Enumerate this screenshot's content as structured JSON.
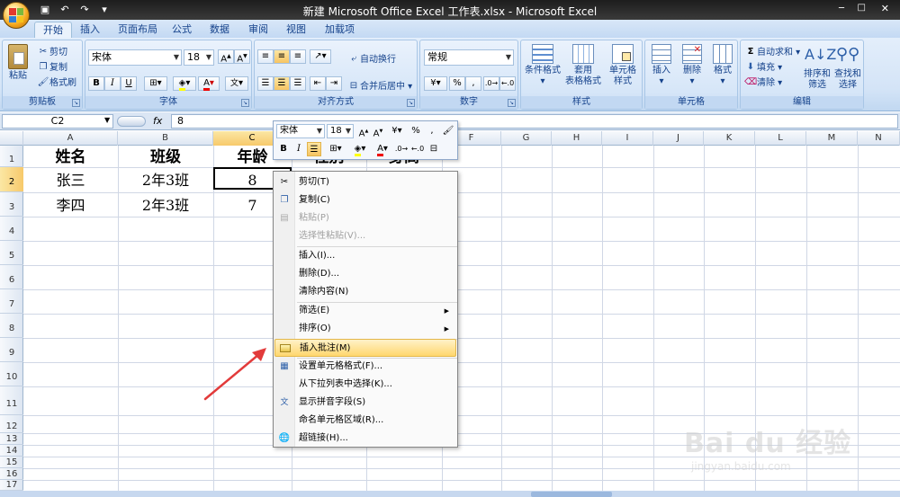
{
  "window": {
    "title": "新建 Microsoft Office Excel 工作表.xlsx - Microsoft Excel"
  },
  "tabs": [
    "开始",
    "插入",
    "页面布局",
    "公式",
    "数据",
    "审阅",
    "视图",
    "加载项"
  ],
  "ribbon": {
    "clipboard": {
      "label": "剪贴板",
      "paste": "粘贴",
      "cut": "剪切",
      "copy": "复制",
      "format_painter": "格式刷"
    },
    "font": {
      "label": "字体",
      "font_name": "宋体",
      "font_size": "18",
      "bold": "B",
      "italic": "I",
      "underline": "U"
    },
    "alignment": {
      "label": "对齐方式",
      "wrap": "自动换行",
      "merge": "合并后居中"
    },
    "number": {
      "label": "数字",
      "format": "常规",
      "percent": "%",
      "comma": ","
    },
    "styles": {
      "label": "样式",
      "conditional": "条件格式",
      "table_l1": "套用",
      "table_l2": "表格格式",
      "cell_l1": "单元格",
      "cell_l2": "样式"
    },
    "cells": {
      "label": "单元格",
      "insert": "插入",
      "delete": "删除",
      "format": "格式"
    },
    "editing": {
      "label": "编辑",
      "autosum": "自动求和",
      "fill": "填充",
      "clear": "清除",
      "sort_l1": "排序和",
      "sort_l2": "筛选",
      "find_l1": "查找和",
      "find_l2": "选择"
    }
  },
  "formula_bar": {
    "name_box": "C2",
    "fx": "fx",
    "value": "8"
  },
  "sheet": {
    "columns": [
      "A",
      "B",
      "C",
      "D",
      "E",
      "F",
      "G",
      "H",
      "I",
      "J",
      "K",
      "L",
      "M",
      "N"
    ],
    "rows": [
      "1",
      "2",
      "3",
      "4",
      "5",
      "6",
      "7",
      "8",
      "9",
      "10",
      "11",
      "12",
      "13",
      "14",
      "15",
      "16",
      "17"
    ],
    "cells": {
      "A1": "姓名",
      "B1": "班级",
      "C1": "年龄",
      "D1": "性别",
      "E1": "身高",
      "A2": "张三",
      "B2": "2年3班",
      "C2": "8",
      "A3": "李四",
      "B3": "2年3班",
      "C3": "7"
    }
  },
  "mini_toolbar": {
    "font_name": "宋体",
    "font_size": "18",
    "percent": "%",
    "comma": ",",
    "bold": "B",
    "italic": "I"
  },
  "context_menu": {
    "items": [
      {
        "label": "剪切(T)",
        "icon": "scissors-icon",
        "disabled": false
      },
      {
        "label": "复制(C)",
        "icon": "copy-icon",
        "disabled": false
      },
      {
        "label": "粘贴(P)",
        "icon": "paste-icon",
        "disabled": true
      },
      {
        "label": "选择性粘贴(V)...",
        "icon": "",
        "disabled": true
      },
      {
        "label": "插入(I)...",
        "icon": "",
        "disabled": false
      },
      {
        "label": "删除(D)...",
        "icon": "",
        "disabled": false
      },
      {
        "label": "清除内容(N)",
        "icon": "",
        "disabled": false
      },
      {
        "label": "筛选(E)",
        "icon": "",
        "disabled": false,
        "submenu": true
      },
      {
        "label": "排序(O)",
        "icon": "",
        "disabled": false,
        "submenu": true
      },
      {
        "label": "插入批注(M)",
        "icon": "comment-icon",
        "disabled": false,
        "highlighted": true
      },
      {
        "label": "设置单元格格式(F)...",
        "icon": "format-cells-icon",
        "disabled": false
      },
      {
        "label": "从下拉列表中选择(K)...",
        "icon": "",
        "disabled": false
      },
      {
        "label": "显示拼音字段(S)",
        "icon": "phonetic-icon",
        "disabled": false
      },
      {
        "label": "命名单元格区域(R)...",
        "icon": "",
        "disabled": false
      },
      {
        "label": "超链接(H)...",
        "icon": "hyperlink-icon",
        "disabled": false
      }
    ]
  },
  "watermark": {
    "logo": "Bai du 经验",
    "sub": "jingyan.baidu.com"
  },
  "colors": {
    "accent": "#15428b",
    "selection": "#f7c96b",
    "arrow": "#e23b3b"
  }
}
